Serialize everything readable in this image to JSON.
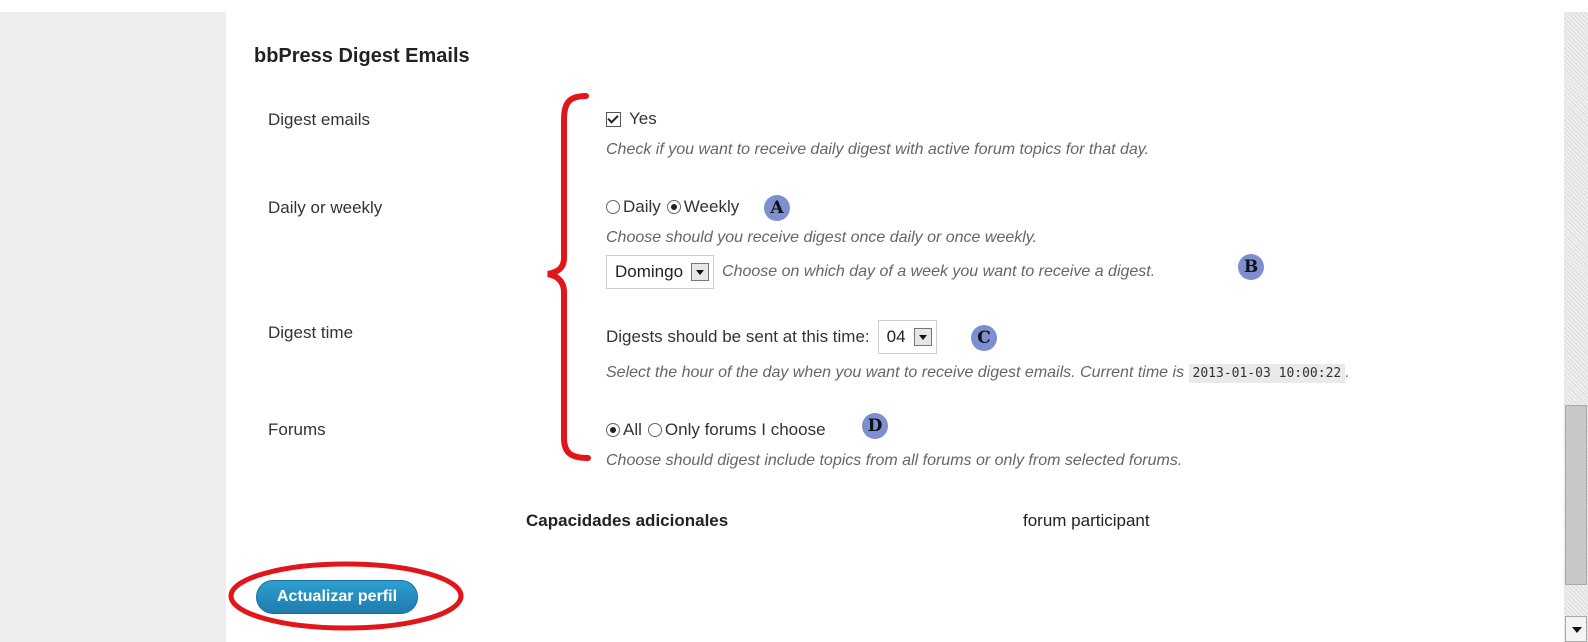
{
  "section": {
    "title": "bbPress Digest Emails"
  },
  "rows": {
    "digest_emails": {
      "label": "Digest emails",
      "checkbox_label": "Yes",
      "checked": true,
      "description": "Check if you want to receive daily digest with active forum topics for that day."
    },
    "daily_weekly": {
      "label": "Daily or weekly",
      "option_daily": "Daily",
      "option_weekly": "Weekly",
      "selected": "Weekly",
      "badge": "A",
      "description": "Choose should you receive digest once daily or once weekly.",
      "day_select_value": "Domingo",
      "day_description": "Choose on which day of a week you want to receive a digest.",
      "day_badge": "B"
    },
    "digest_time": {
      "label": "Digest time",
      "prefix": "Digests should be sent at this time:",
      "hour_value": "04",
      "badge": "C",
      "description": "Select the hour of the day when you want to receive digest emails. Current time is",
      "current_time": "2013-01-03 10:00:22",
      "suffix": "."
    },
    "forums": {
      "label": "Forums",
      "option_all": "All",
      "option_some": "Only forums I choose",
      "selected": "All",
      "badge": "D",
      "description": "Choose should digest include topics from all forums or only from selected forums."
    }
  },
  "capabilities": {
    "label": "Capacidades adicionales",
    "value": "forum participant"
  },
  "submit": {
    "label": "Actualizar perfil"
  },
  "colors": {
    "annotation_red": "#e0161b",
    "badge_blue": "#7d8fd1",
    "button_blue": "#2384b8"
  }
}
